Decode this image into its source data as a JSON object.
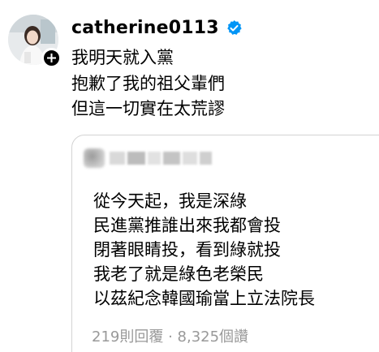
{
  "post": {
    "username": "catherine0113",
    "lines": [
      "我明天就入黨",
      "抱歉了我的祖父輩們",
      "但這一切實在太荒謬"
    ]
  },
  "quote": {
    "lines": [
      "從今天起，我是深綠",
      "民進黨推誰出來我都會投",
      "閉著眼睛投，看到綠就投",
      "我老了就是綠色老榮民",
      "以茲紀念韓國瑜當上立法院長"
    ],
    "stats": "219則回覆 · 8,325個讚"
  },
  "colors": {
    "verified": "#0095f6",
    "muted_text": "#999999",
    "card_border": "#d3d3d3"
  },
  "icons": {
    "verified": "verified-badge-icon",
    "follow": "plus-icon"
  }
}
